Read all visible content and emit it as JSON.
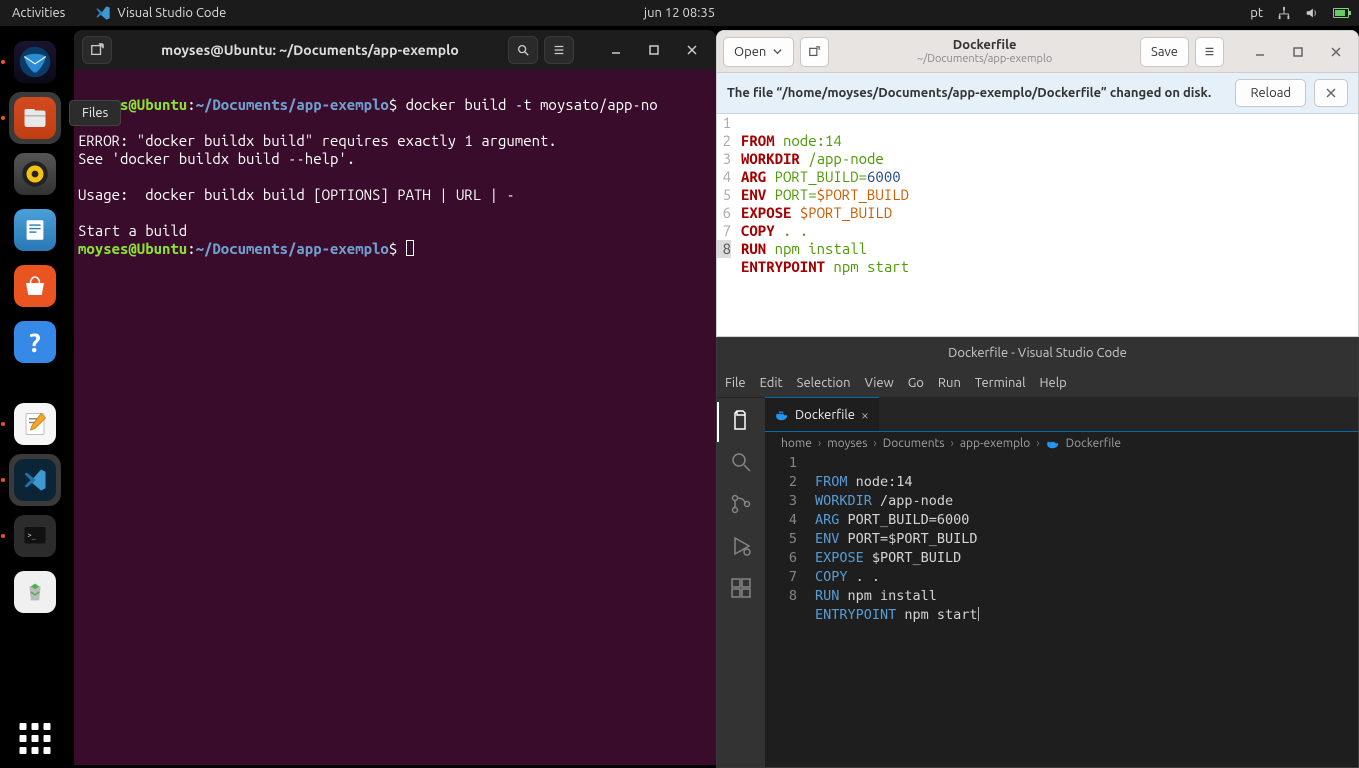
{
  "topbar": {
    "activities": "Activities",
    "app_name": "Visual Studio Code",
    "datetime": "jun 12  08:35",
    "lang": "pt"
  },
  "dock": {
    "tooltip_files": "Files"
  },
  "terminal": {
    "title": "moyses@Ubuntu: ~/Documents/app-exemplo",
    "prompt_user": "moyses@Ubuntu",
    "prompt_sep": ":",
    "prompt_path": "~/Documents/app-exemplo",
    "prompt_end": "$",
    "cmd1": " docker build -t moysato/app-no",
    "line_blank": "",
    "err1": "ERROR: \"docker buildx build\" requires exactly 1 argument.",
    "err2": "See 'docker buildx build --help'.",
    "err3_blank": "",
    "usage": "Usage:  docker buildx build [OPTIONS] PATH | URL | -",
    "usage_blank": "",
    "start": "Start a build"
  },
  "gedit": {
    "open": "Open",
    "save": "Save",
    "reload": "Reload",
    "title": "Dockerfile",
    "subtitle": "~/Documents/app-exemplo",
    "notif": "The file “/home/moyses/Documents/app-exemplo/Dockerfile” changed on disk.",
    "lines": {
      "n1": "1",
      "n2": "2",
      "n3": "3",
      "n4": "4",
      "n5": "5",
      "n6": "6",
      "n7": "7",
      "n8": "8",
      "l1_kw": "FROM",
      "l1_rest": " node:14",
      "l2_kw": "WORKDIR",
      "l2_rest": " /app-node",
      "l3_kw": "ARG",
      "l3_mid": " PORT_BUILD=",
      "l3_val": "6000",
      "l4_kw": "ENV",
      "l4_mid": " PORT=",
      "l4_var": "$PORT_BUILD",
      "l5_kw": "EXPOSE",
      "l5_sp": " ",
      "l5_var": "$PORT_BUILD",
      "l6_kw": "COPY",
      "l6_rest": " . .",
      "l7_kw": "RUN",
      "l7_rest": " npm install",
      "l8_kw": "ENTRYPOINT",
      "l8_rest": " npm start"
    }
  },
  "vscode": {
    "title": "Dockerfile - Visual Studio Code",
    "menu": {
      "file": "File",
      "edit": "Edit",
      "selection": "Selection",
      "view": "View",
      "go": "Go",
      "run": "Run",
      "terminal": "Terminal",
      "help": "Help"
    },
    "tab": "Dockerfile",
    "breadcrumb": {
      "p0": "home",
      "p1": "moyses",
      "p2": "Documents",
      "p3": "app-exemplo",
      "p4": "Dockerfile"
    },
    "lines": {
      "n1": "1",
      "n2": "2",
      "n3": "3",
      "n4": "4",
      "n5": "5",
      "n6": "6",
      "n7": "7",
      "n8": "8",
      "l1_kw": "FROM",
      "l1_rest": " node:14",
      "l2_kw": "WORKDIR",
      "l2_rest": " /app-node",
      "l3_kw": "ARG",
      "l3_rest": " PORT_BUILD=6000",
      "l4_kw": "ENV",
      "l4_rest": " PORT=$PORT_BUILD",
      "l5_kw": "EXPOSE",
      "l5_rest": " $PORT_BUILD",
      "l6_kw": "COPY",
      "l6_rest": " . .",
      "l7_kw": "RUN",
      "l7_rest": " npm install",
      "l8_kw": "ENTRYPOINT",
      "l8_rest": " npm start"
    }
  }
}
